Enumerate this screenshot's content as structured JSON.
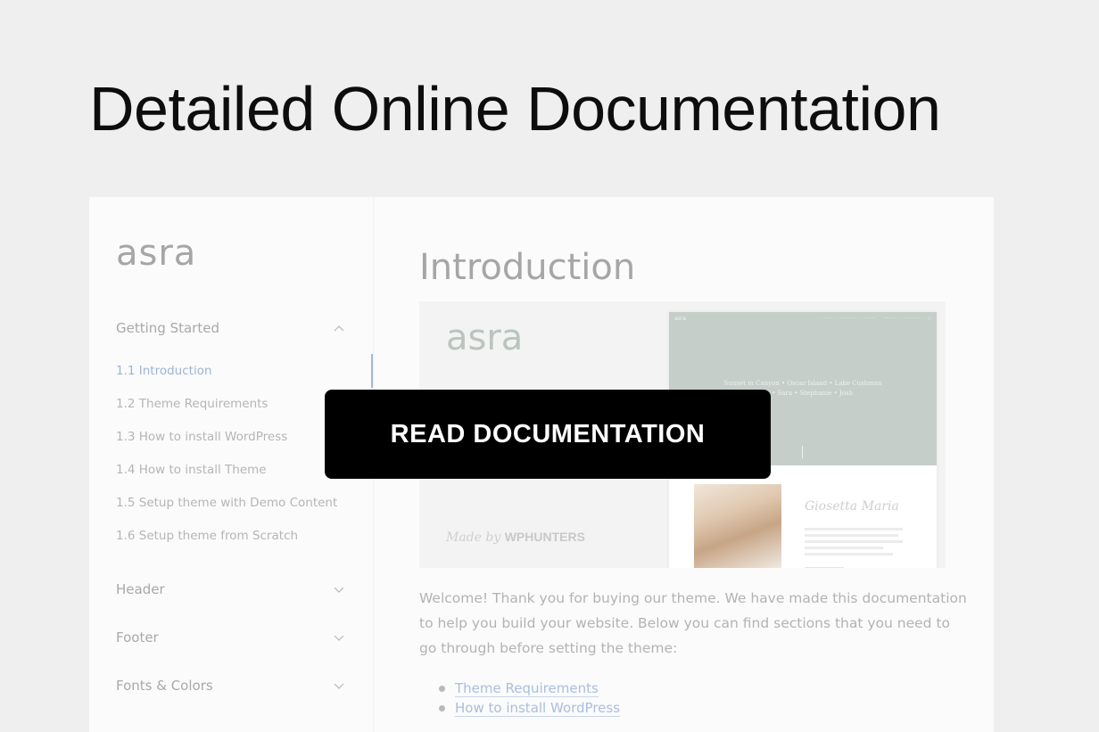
{
  "heading": "Detailed Online Documentation",
  "cta": {
    "label": "READ DOCUMENTATION"
  },
  "sidebar": {
    "logo": "asra",
    "sections": [
      {
        "label": "Getting Started",
        "expanded": true
      },
      {
        "label": "Header",
        "expanded": false
      },
      {
        "label": "Footer",
        "expanded": false
      },
      {
        "label": "Fonts & Colors",
        "expanded": false
      }
    ],
    "items": [
      {
        "label": "1.1 Introduction",
        "active": true
      },
      {
        "label": "1.2 Theme Requirements",
        "active": false
      },
      {
        "label": "1.3 How to install WordPress",
        "active": false
      },
      {
        "label": "1.4 How to install Theme",
        "active": false
      },
      {
        "label": "1.5 Setup theme with Demo Content",
        "active": false
      },
      {
        "label": "1.6 Setup theme from Scratch",
        "active": false
      }
    ]
  },
  "main": {
    "title": "Introduction",
    "preview": {
      "logo": "asra",
      "made_by": "Made by",
      "made_by_brand": "WPHUNTERS",
      "site_logo": "asra",
      "tagline_1": "Sunset in Canyon • Oscar Island • Lake Cushman",
      "tagline_2": "Chris • Sara • Stephanie • Josh",
      "person_name": "Giosetta Maria"
    },
    "intro": "Welcome! Thank you for buying our theme. We have made this documentation to help you build your website. Below you can find sections that you need to go through before setting the theme:",
    "links": [
      "Theme Requirements",
      "How to install WordPress"
    ]
  },
  "colors": {
    "page_bg": "#efefef",
    "accent": "#a3b9da",
    "cta_bg": "#000000",
    "cta_text": "#ffffff"
  },
  "icons": {
    "collapse": "chevron-up-icon",
    "expand": "chevron-down-icon"
  }
}
